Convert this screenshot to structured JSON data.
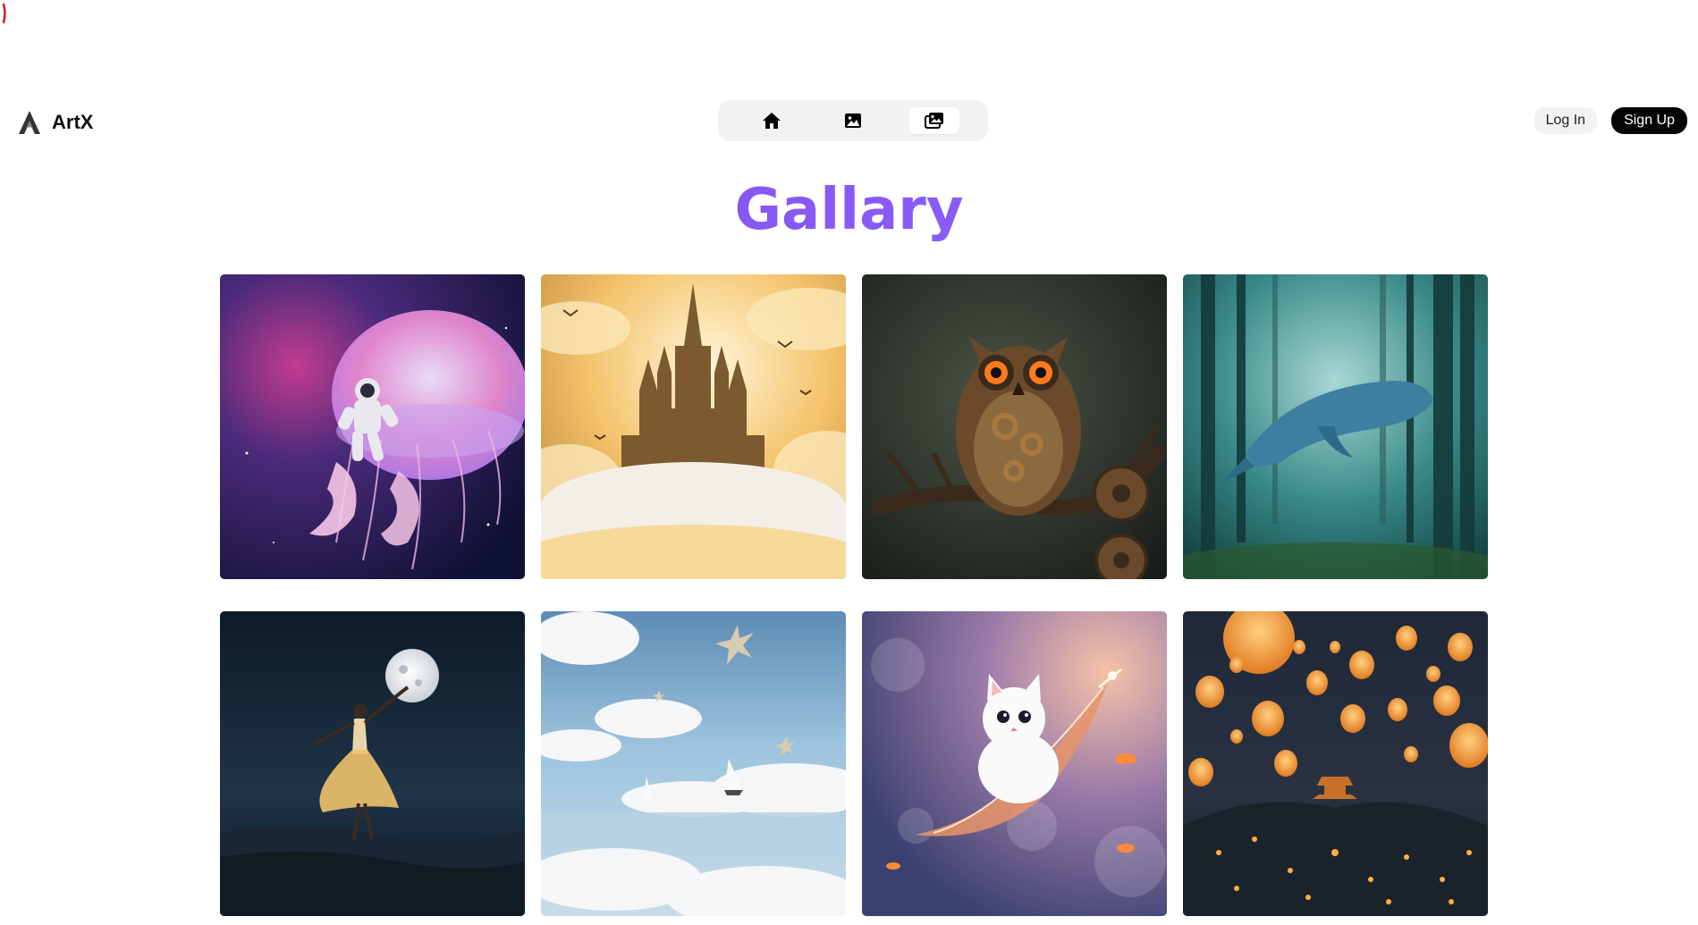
{
  "app": {
    "name": "ArtX"
  },
  "nav": {
    "items": [
      {
        "icon": "home-icon"
      },
      {
        "icon": "image-icon"
      },
      {
        "icon": "gallery-icon",
        "active": true
      }
    ]
  },
  "auth": {
    "login_label": "Log In",
    "signup_label": "Sign Up"
  },
  "page": {
    "title": "Gallary"
  },
  "colors": {
    "title_gradient_start": "#7a4cf5",
    "title_gradient_end": "#6a7cf5",
    "nav_bg": "#f1f2f4",
    "signup_bg": "#050505"
  },
  "gallery": {
    "images": [
      {
        "subject": "jellyfish-astronaut"
      },
      {
        "subject": "castle-in-clouds"
      },
      {
        "subject": "steampunk-owl"
      },
      {
        "subject": "whale-in-forest"
      },
      {
        "subject": "moon-dancer"
      },
      {
        "subject": "sky-sailboats"
      },
      {
        "subject": "cat-on-feather"
      },
      {
        "subject": "sky-lanterns"
      }
    ]
  }
}
